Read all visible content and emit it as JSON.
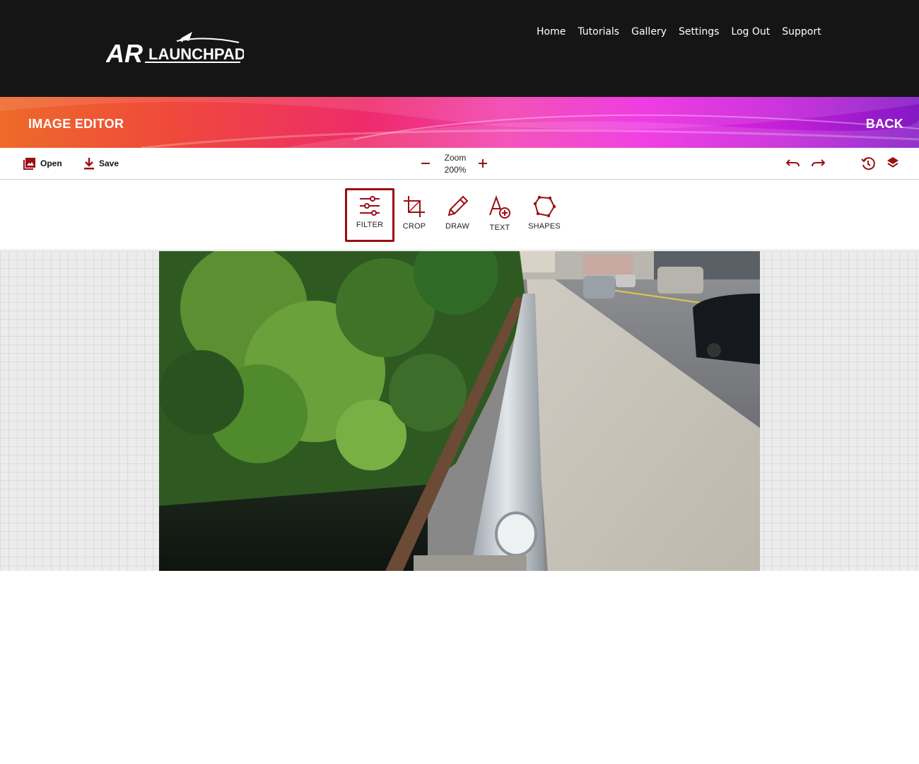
{
  "header": {
    "logo_text_ar": "AR",
    "logo_text_launchpad": "LAUNCHPAD",
    "nav": [
      "Home",
      "Tutorials",
      "Gallery",
      "Settings",
      "Log Out",
      "Support"
    ]
  },
  "banner": {
    "title": "IMAGE EDITOR",
    "back": "BACK"
  },
  "toolbar": {
    "open_label": "Open",
    "save_label": "Save",
    "zoom_label": "Zoom",
    "zoom_value": "200%"
  },
  "tools": [
    {
      "label": "FILTER",
      "icon": "sliders-icon",
      "active": true
    },
    {
      "label": "CROP",
      "icon": "crop-icon",
      "active": false
    },
    {
      "label": "DRAW",
      "icon": "pencil-icon",
      "active": false
    },
    {
      "label": "TEXT",
      "icon": "text-add-icon",
      "active": false
    },
    {
      "label": "SHAPES",
      "icon": "polygon-icon",
      "active": false
    }
  ],
  "colors": {
    "accent": "#9b0e14",
    "header_bg": "#141514"
  }
}
